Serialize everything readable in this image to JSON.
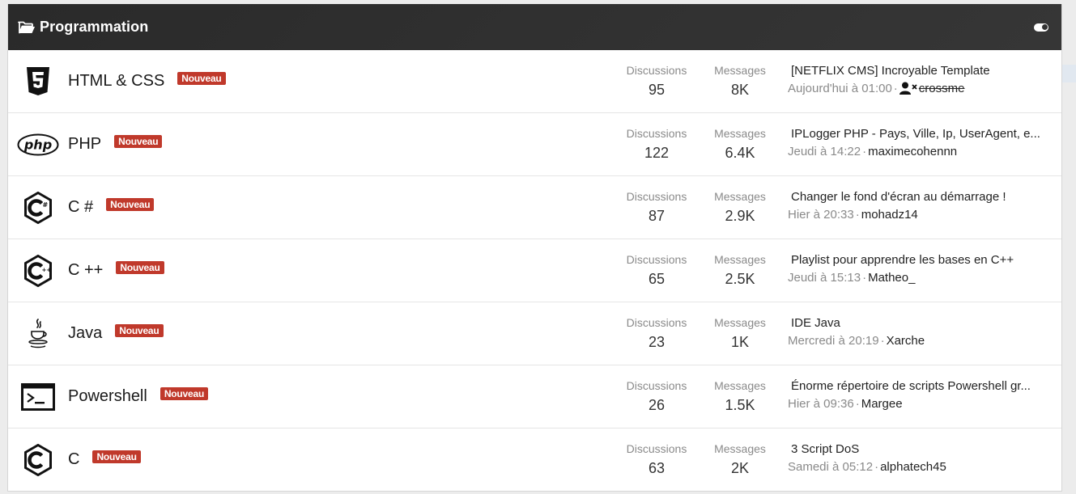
{
  "category": {
    "title": "Programmation",
    "folder_icon": "folder-open-icon",
    "toggle_icon": "toggle-icon"
  },
  "labels": {
    "discussions": "Discussions",
    "messages": "Messages",
    "badge": "Nouveau"
  },
  "colors": {
    "header_bg": "#2e2e2e",
    "badge_bg": "#c0392b"
  },
  "nodes": [
    {
      "name": "HTML & CSS",
      "icon": "html5-icon",
      "discussions": "95",
      "messages": "8K",
      "last_title": "[NETFLIX CMS] Incroyable Template",
      "last_date": "Aujourd'hui à 01:00",
      "last_user": "crossme",
      "user_banned": true
    },
    {
      "name": "PHP",
      "icon": "php-icon",
      "discussions": "122",
      "messages": "6.4K",
      "last_title": "IPLogger PHP - Pays, Ville, Ip, UserAgent, e...",
      "last_date": "Jeudi à 14:22",
      "last_user": "maximecohennn"
    },
    {
      "name": "C #",
      "icon": "csharp-icon",
      "discussions": "87",
      "messages": "2.9K",
      "last_title": "Changer le fond d'écran au démarrage !",
      "last_date": "Hier à 20:33",
      "last_user": "mohadz14"
    },
    {
      "name": "C ++",
      "icon": "cpp-icon",
      "discussions": "65",
      "messages": "2.5K",
      "last_title": "Playlist pour apprendre les bases en C++",
      "last_date": "Jeudi à 15:13",
      "last_user": "Matheo_"
    },
    {
      "name": "Java",
      "icon": "java-icon",
      "discussions": "23",
      "messages": "1K",
      "last_title": "IDE Java",
      "last_date": "Mercredi à 20:19",
      "last_user": "Xarche"
    },
    {
      "name": "Powershell",
      "icon": "terminal-icon",
      "discussions": "26",
      "messages": "1.5K",
      "last_title": "Énorme répertoire de scripts Powershell gr...",
      "last_date": "Hier à 09:36",
      "last_user": "Margee"
    },
    {
      "name": "C",
      "icon": "c-icon",
      "discussions": "63",
      "messages": "2K",
      "last_title": "3 Script DoS",
      "last_date": "Samedi à 05:12",
      "last_user": "alphatech45"
    }
  ]
}
